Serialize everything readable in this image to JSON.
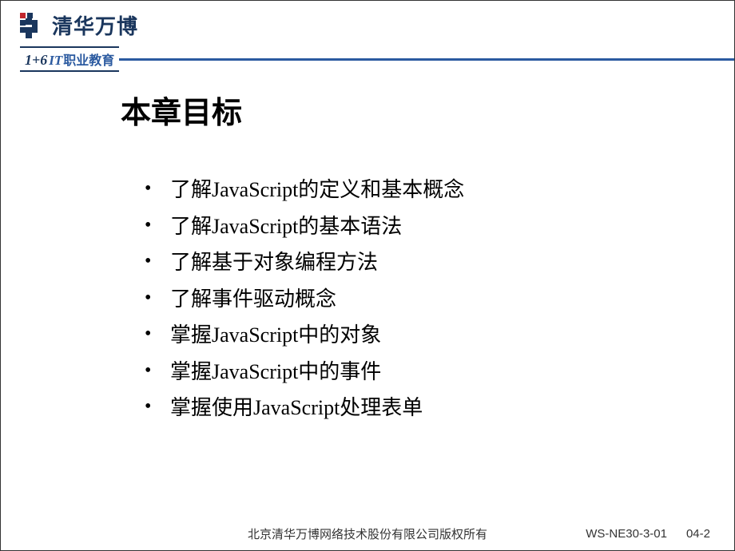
{
  "header": {
    "logo_text": "清华万博",
    "subtitle_onesix": "1+6",
    "subtitle_it": "IT",
    "subtitle_cn": "职业教育"
  },
  "content": {
    "title": "本章目标",
    "bullets": [
      "了解JavaScript的定义和基本概念",
      "了解JavaScript的基本语法",
      "了解基于对象编程方法",
      "了解事件驱动概念",
      "掌握JavaScript中的对象",
      "掌握JavaScript中的事件",
      "掌握使用JavaScript处理表单"
    ]
  },
  "footer": {
    "copyright": "北京清华万博网络技术股份有限公司版权所有",
    "doc_code": "WS-NE30-3-01",
    "page_num": "04-2"
  }
}
